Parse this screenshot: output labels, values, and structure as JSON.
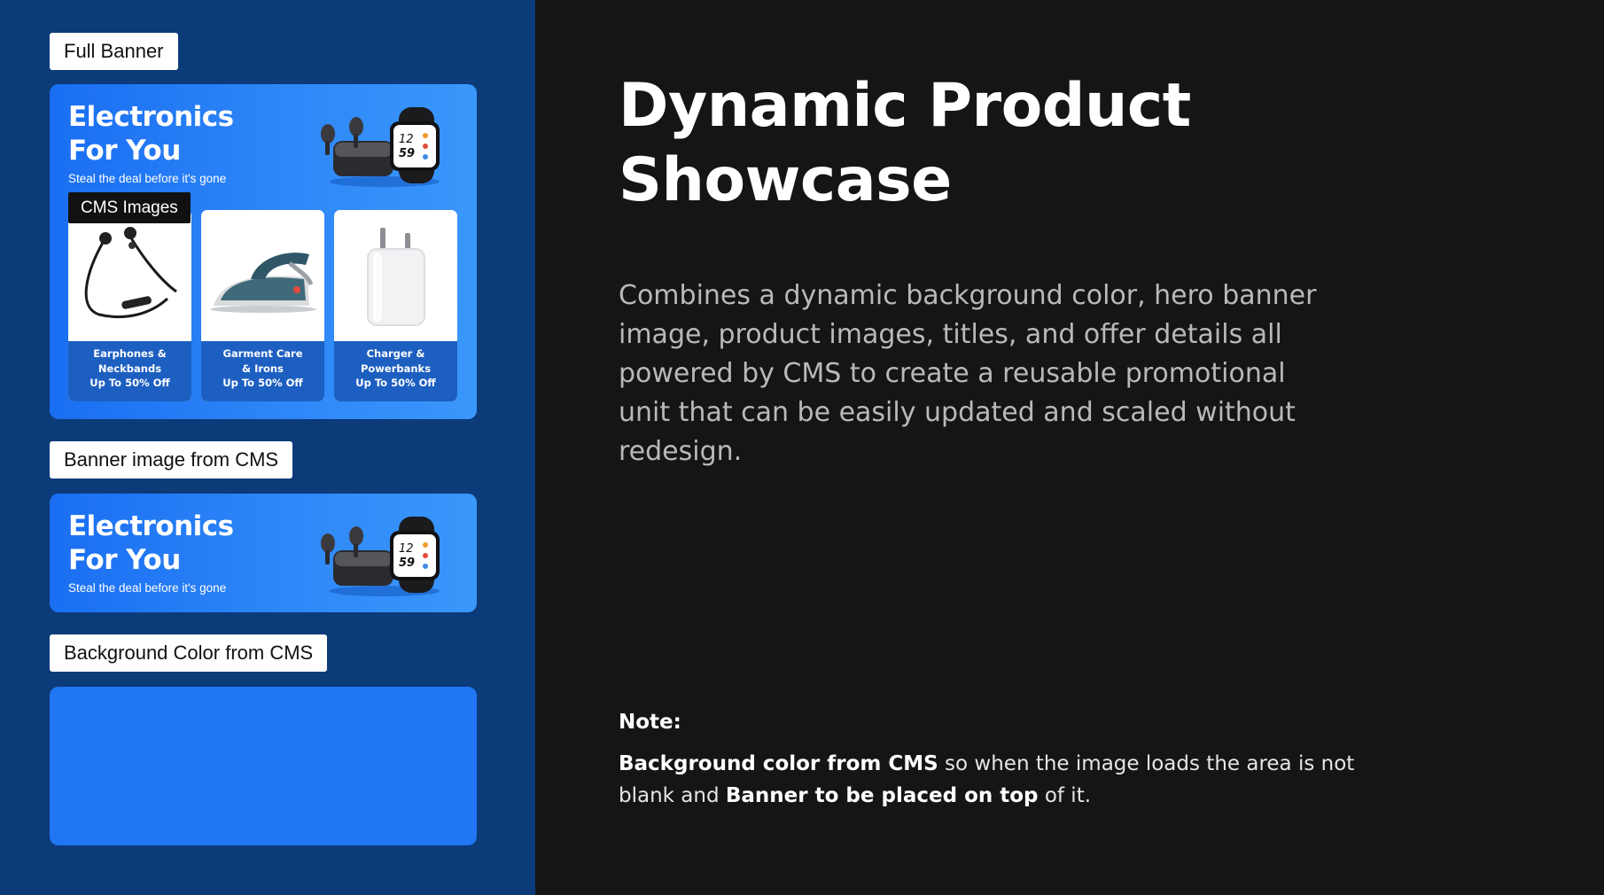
{
  "left": {
    "full_banner_tag": "Full Banner",
    "banner_image_tag": "Banner image from CMS",
    "bg_color_tag": "Background Color from CMS",
    "banner": {
      "title": "Electronics\nFor You",
      "subtitle": "Steal the deal before it's gone"
    },
    "cms_images_tag": "CMS Images",
    "products": [
      {
        "line1": "Earphones &",
        "line2": "Neckbands",
        "offer": "Up To 50% Off",
        "icon": "neckband-earphones-icon"
      },
      {
        "line1": "Garment Care",
        "line2": "& Irons",
        "offer": "Up To 50% Off",
        "icon": "steam-iron-icon"
      },
      {
        "line1": "Charger &",
        "line2": "Powerbanks",
        "offer": "Up To 50% Off",
        "icon": "wall-charger-icon"
      }
    ]
  },
  "right": {
    "title": "Dynamic Product Showcase",
    "description": "Combines a dynamic background color, hero banner image, product images, titles, and offer details all powered by CMS to create a reusable promotional unit that can be easily updated and scaled without redesign.",
    "note_label": "Note:",
    "note": {
      "bold1": "Background color from CMS",
      "text1": " so when the image loads the area is not blank and ",
      "bold2": "Banner to be placed on top",
      "text2": " of it."
    }
  },
  "colors": {
    "left_panel": "#0c3b7a",
    "right_panel": "#151515",
    "banner_blue": "#2176f4",
    "card_footer": "#1d5fc1"
  }
}
